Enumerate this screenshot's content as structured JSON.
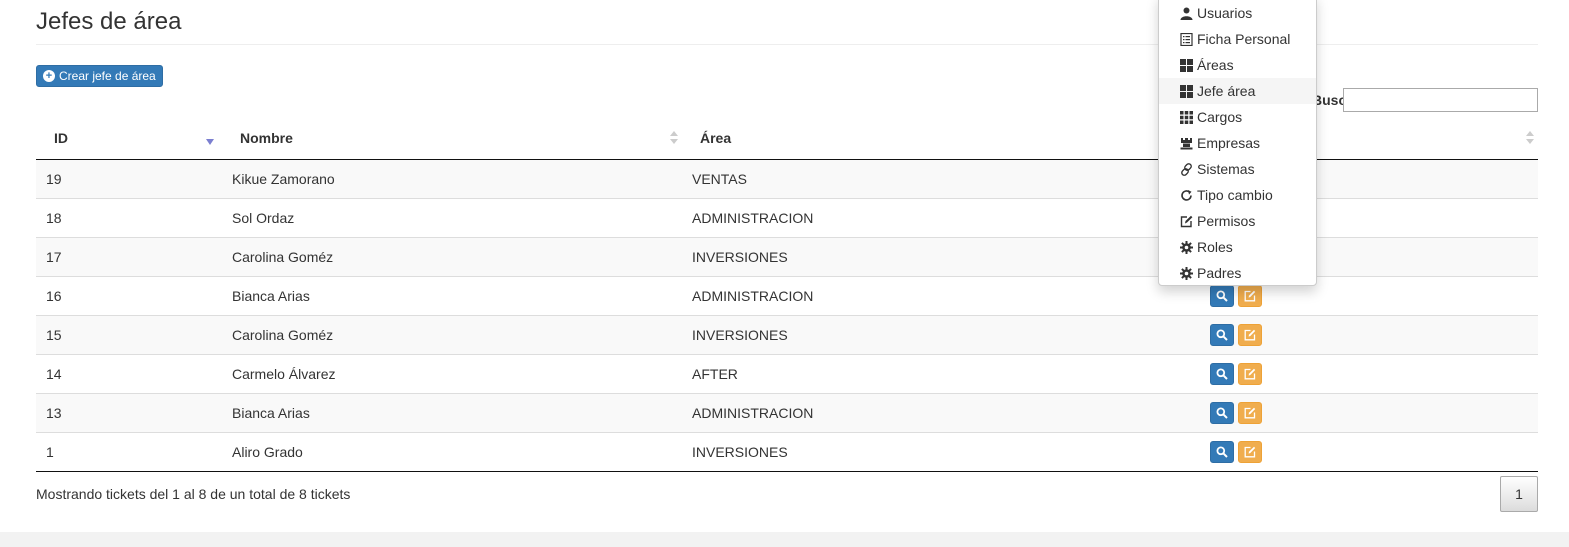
{
  "header": {
    "title": "Jefes de área",
    "create_button": "Crear jefe de área"
  },
  "search": {
    "label": "Buscar",
    "value": ""
  },
  "table": {
    "columns": [
      "ID",
      "Nombre",
      "Área",
      ""
    ],
    "rows": [
      {
        "id": "19",
        "nombre": "Kikue Zamorano",
        "area": "VENTAS"
      },
      {
        "id": "18",
        "nombre": "Sol Ordaz",
        "area": "ADMINISTRACION"
      },
      {
        "id": "17",
        "nombre": "Carolina Goméz",
        "area": "INVERSIONES"
      },
      {
        "id": "16",
        "nombre": "Bianca Arias",
        "area": "ADMINISTRACION"
      },
      {
        "id": "15",
        "nombre": "Carolina Goméz",
        "area": "INVERSIONES"
      },
      {
        "id": "14",
        "nombre": "Carmelo Álvarez",
        "area": "AFTER"
      },
      {
        "id": "13",
        "nombre": "Bianca Arias",
        "area": "ADMINISTRACION"
      },
      {
        "id": "1",
        "nombre": "Aliro Grado",
        "area": "INVERSIONES"
      }
    ]
  },
  "footer": {
    "info": "Mostrando tickets del 1 al 8 de un total de 8 tickets",
    "page": "1"
  },
  "menu": {
    "items": [
      {
        "label": "Usuarios",
        "icon": "user-icon"
      },
      {
        "label": "Ficha Personal",
        "icon": "list-alt-icon"
      },
      {
        "label": "Áreas",
        "icon": "th-large-icon"
      },
      {
        "label": "Jefe área",
        "icon": "th-large-icon"
      },
      {
        "label": "Cargos",
        "icon": "th-icon"
      },
      {
        "label": "Empresas",
        "icon": "tower-icon"
      },
      {
        "label": "Sistemas",
        "icon": "link-icon"
      },
      {
        "label": "Tipo cambio",
        "icon": "refresh-icon"
      },
      {
        "label": "Permisos",
        "icon": "edit-icon"
      },
      {
        "label": "Roles",
        "icon": "cog-icon"
      },
      {
        "label": "Padres",
        "icon": "cog-icon"
      }
    ]
  },
  "colors": {
    "primary": "#337ab7",
    "warning": "#f0ad4e",
    "sort_active": "#7b7fd0"
  }
}
